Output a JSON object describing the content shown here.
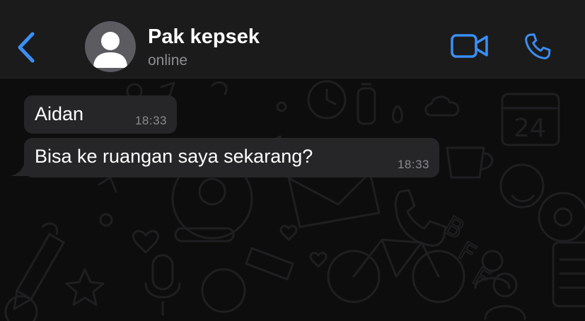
{
  "header": {
    "contact_name": "Pak kepsek",
    "status": "online",
    "back_icon": "chevron-left-icon",
    "video_icon": "video-camera-icon",
    "call_icon": "phone-icon",
    "avatar_icon": "person-silhouette-icon"
  },
  "messages": [
    {
      "text": "Aidan",
      "time": "18:33"
    },
    {
      "text": "Bisa ke ruangan saya sekarang?",
      "time": "18:33"
    }
  ],
  "colors": {
    "header_bg": "#1b1b1b",
    "accent": "#3b8ff5",
    "bubble_bg": "#262628",
    "chat_bg": "#0d0d0d",
    "muted_text": "#8e8e93"
  }
}
